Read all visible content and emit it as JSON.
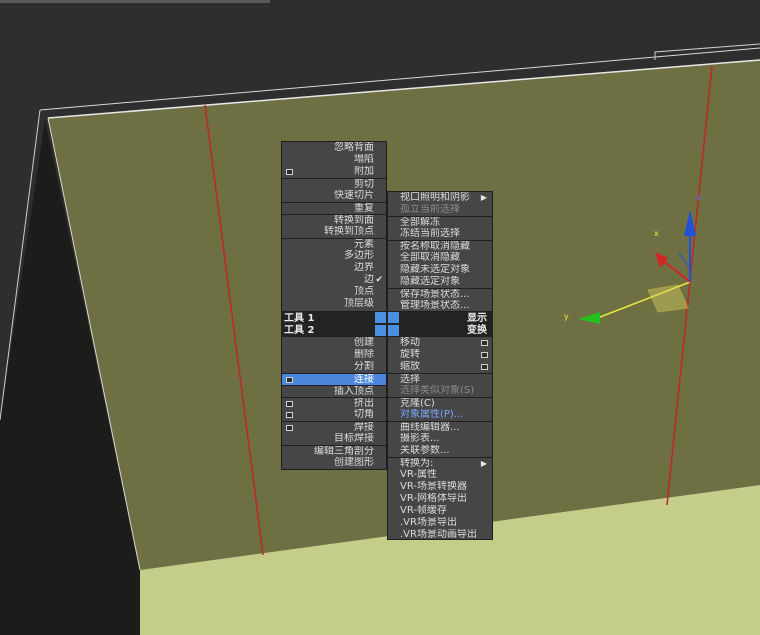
{
  "colors": {
    "viewport_bg": "#2b2b2b",
    "plane_color": "#6f6f44",
    "floor_color": "#c5cd8a",
    "menu_bg": "#464646",
    "menu_header_bg": "#232323",
    "highlight": "#4b86dc",
    "edge_red": "#c0281f",
    "gizmo_blue": "#1f52d8",
    "gizmo_red": "#d42424",
    "gizmo_green": "#22c020",
    "gizmo_yellow": "#e8e840"
  },
  "gizmo": {
    "x_label": "x",
    "y_label": "y",
    "z_label": "z"
  },
  "quad_menu": {
    "tools1_label": "工具 1",
    "tools2_label": "工具 2",
    "display_label": "显示",
    "transform_label": "变换",
    "top_left": [
      {
        "label": "忽略背面",
        "box": false
      },
      {
        "label": "塌陷",
        "box": false
      },
      {
        "label": "附加",
        "box": true
      },
      {
        "label": "剪切",
        "box": false
      },
      {
        "label": "快速切片",
        "box": false
      },
      {
        "label": "重复",
        "box": false
      },
      {
        "label": "转换到面",
        "box": false
      },
      {
        "label": "转换到顶点",
        "box": false
      },
      {
        "label": "元素",
        "box": false
      },
      {
        "label": "多边形",
        "box": false
      },
      {
        "label": "边界",
        "box": false
      },
      {
        "label": "边",
        "box": false,
        "check": "✔"
      },
      {
        "label": "顶点",
        "box": false
      },
      {
        "label": "顶层级",
        "box": false
      }
    ],
    "top_right": [
      {
        "label": "视口照明和阴影",
        "arrow": "▶"
      },
      {
        "label": "孤立当前选择",
        "disabled": true
      },
      {
        "label": "全部解冻"
      },
      {
        "label": "冻结当前选择"
      },
      {
        "label": "按名称取消隐藏"
      },
      {
        "label": "全部取消隐藏"
      },
      {
        "label": "隐藏未选定对象"
      },
      {
        "label": "隐藏选定对象"
      },
      {
        "label": "保存场景状态..."
      },
      {
        "label": "管理场景状态..."
      }
    ],
    "bottom_left": [
      {
        "label": "创建",
        "box": false
      },
      {
        "label": "删除",
        "box": false
      },
      {
        "label": "分割",
        "box": false
      },
      {
        "label": "连接",
        "box": true
      },
      {
        "label": "插入顶点",
        "box": false
      },
      {
        "label": "挤出",
        "box": true
      },
      {
        "label": "切角",
        "box": true
      },
      {
        "label": "焊接",
        "box": true
      },
      {
        "label": "目标焊接",
        "box": false
      },
      {
        "label": "编辑三角剖分",
        "box": false
      },
      {
        "label": "创建图形",
        "box": false
      }
    ],
    "bottom_right": [
      {
        "label": "移动",
        "box": true
      },
      {
        "label": "旋转",
        "box": true
      },
      {
        "label": "缩放",
        "box": true
      },
      {
        "label": "选择"
      },
      {
        "label": "选择类似对象(S)",
        "disabled": true
      },
      {
        "label": "克隆(C)"
      },
      {
        "label": "对象属性(P)..."
      },
      {
        "label": "曲线编辑器..."
      },
      {
        "label": "摄影表..."
      },
      {
        "label": "关联参数..."
      },
      {
        "label": "转换为:",
        "arrow": "▶"
      },
      {
        "label": "VR-属性"
      },
      {
        "label": "VR-场景转换器"
      },
      {
        "label": "VR-网格体导出"
      },
      {
        "label": "VR-帧缓存"
      },
      {
        "label": ".VR场景导出"
      },
      {
        "label": ".VR场景动画导出"
      }
    ]
  }
}
